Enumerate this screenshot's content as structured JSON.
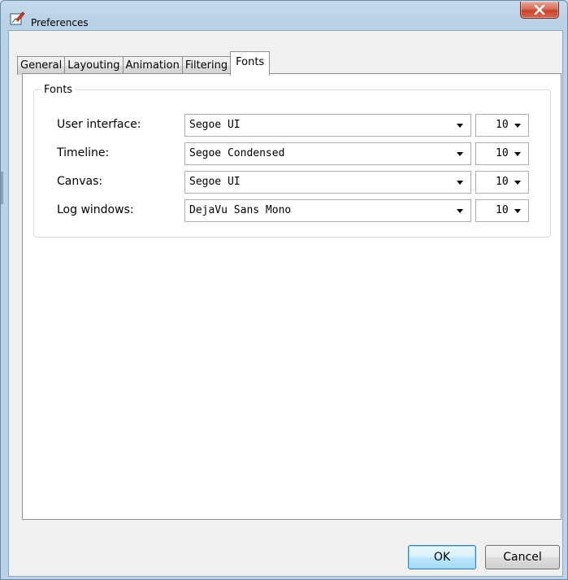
{
  "window": {
    "title": "Preferences"
  },
  "tabs": [
    {
      "label": "General",
      "active": false
    },
    {
      "label": "Layouting",
      "active": false
    },
    {
      "label": "Animation",
      "active": false
    },
    {
      "label": "Filtering",
      "active": false
    },
    {
      "label": "Fonts",
      "active": true
    }
  ],
  "fonts_group": {
    "title": "Fonts",
    "rows": [
      {
        "label": "User interface:",
        "font": "Segoe UI",
        "size": "10"
      },
      {
        "label": "Timeline:",
        "font": "Segoe Condensed",
        "size": "10"
      },
      {
        "label": "Canvas:",
        "font": "Segoe UI",
        "size": "10"
      },
      {
        "label": "Log windows:",
        "font": "DejaVu Sans Mono",
        "size": "10"
      }
    ]
  },
  "buttons": {
    "ok": "OK",
    "cancel": "Cancel"
  },
  "icons": {
    "app": "preferences-edit-icon",
    "close": "close-icon",
    "dropdown": "chevron-down-icon"
  },
  "colors": {
    "close_button": "#c7432a",
    "default_button_border": "#3c7fb1",
    "window_frame": "#b9d1e6"
  }
}
